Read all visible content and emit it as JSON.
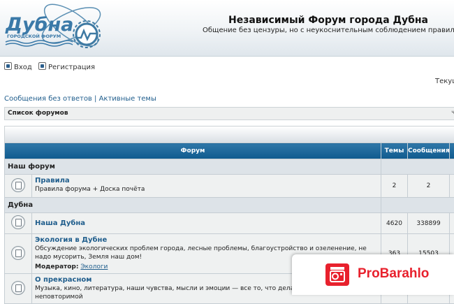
{
  "header": {
    "logo_text": "Дубна",
    "logo_subtext": "ГОРОДСКОЙ ФОРУМ",
    "site_title": "Независимый Форум города Дубна",
    "site_description": "Общение без цензуры, но с неукоснительным соблюдением правил."
  },
  "userbar": {
    "login_label": "Вход",
    "register_label": "Регистрация",
    "time_text": "Текуще"
  },
  "search_links": {
    "unanswered": "Сообщения без ответов",
    "separator": "|",
    "active": "Активные темы"
  },
  "breadcrumb": {
    "label": "Список форумов",
    "tail": "ч"
  },
  "table": {
    "headers": {
      "forum": "Форум",
      "topics": "Темы",
      "posts": "Сообщения"
    },
    "categories": [
      {
        "name": "Наш форум",
        "forums": [
          {
            "name": "Правила",
            "description": "Правила форума + Доска почёта",
            "topics": "2",
            "posts": "2"
          }
        ]
      },
      {
        "name": "Дубна",
        "forums": [
          {
            "name": "Наша Дубна",
            "description": "",
            "topics": "4620",
            "posts": "338899"
          },
          {
            "name": "Экология в Дубне",
            "description": "Обсуждение экологических проблем города, лесные проблемы, благоустройство и озеленение, не надо мусорить, Земля наш дом!",
            "moderator_label": "Модератор:",
            "moderator": "Экологи",
            "topics": "363",
            "posts": "15503"
          },
          {
            "name": "О прекрасном",
            "description": "Музыка, кино, литература, наши чувства, мысли и эмоции — все то, что делает нашу жи",
            "description_tail": "неповторимой",
            "topics": "",
            "posts": ""
          }
        ]
      }
    ]
  },
  "watermark": {
    "text": "ProBarahlo"
  },
  "colors": {
    "header_blue": "#0f5a8e",
    "link_blue": "#1f5d8c",
    "watermark_red": "#e8212d"
  }
}
